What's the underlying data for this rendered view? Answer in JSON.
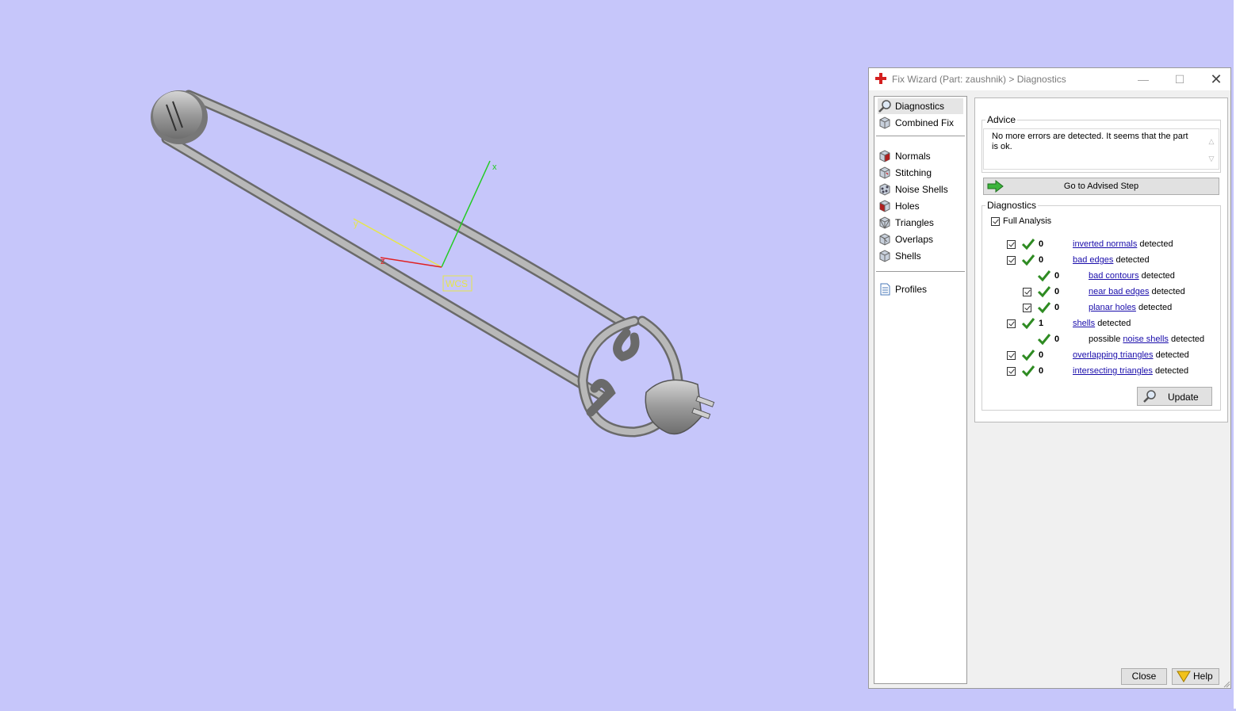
{
  "viewport": {
    "wcs_label": "WCS",
    "axes": {
      "x": "x",
      "y": "y",
      "z": "z"
    },
    "background": "#c6c6fa"
  },
  "dialog": {
    "title": "Fix Wizard (Part: zaushnik) > Diagnostics",
    "steps": [
      {
        "label": "Diagnostics",
        "icon": "magnifier-icon",
        "selected": true
      },
      {
        "label": "Combined Fix",
        "icon": "cube-icon"
      },
      {
        "label": "Normals",
        "icon": "normals-cube-icon"
      },
      {
        "label": "Stitching",
        "icon": "stitching-cube-icon"
      },
      {
        "label": "Noise Shells",
        "icon": "noise-shells-icon"
      },
      {
        "label": "Holes",
        "icon": "holes-cube-icon"
      },
      {
        "label": "Triangles",
        "icon": "triangles-cube-icon"
      },
      {
        "label": "Overlaps",
        "icon": "overlaps-cube-icon"
      },
      {
        "label": "Shells",
        "icon": "shells-cube-icon"
      },
      {
        "label": "Profiles",
        "icon": "document-icon"
      }
    ],
    "advice": {
      "legend": "Advice",
      "text": "No more errors are detected. It seems that the part is ok."
    },
    "advised_button": "Go to Advised Step",
    "diagnostics": {
      "legend": "Diagnostics",
      "full_analysis": "Full Analysis",
      "rows": [
        {
          "count": "0",
          "link": "inverted normals",
          "suffix": "detected",
          "checkbox": true
        },
        {
          "count": "0",
          "link": "bad edges",
          "suffix": "detected",
          "checkbox": true
        },
        {
          "count": "0",
          "link": "bad contours",
          "suffix": "detected",
          "checkbox": false
        },
        {
          "count": "0",
          "link": "near bad edges",
          "suffix": "detected",
          "checkbox": true
        },
        {
          "count": "0",
          "link": "planar holes",
          "suffix": "detected",
          "checkbox": true
        },
        {
          "count": "1",
          "link": "shells",
          "suffix": "detected",
          "checkbox": true
        },
        {
          "count": "0",
          "prefix": "possible",
          "link": "noise shells",
          "suffix": "detected",
          "checkbox": false
        },
        {
          "count": "0",
          "link": "overlapping triangles",
          "suffix": "detected",
          "checkbox": true
        },
        {
          "count": "0",
          "link": "intersecting triangles",
          "suffix": "detected",
          "checkbox": true
        }
      ]
    },
    "update_button": "Update",
    "close_button": "Close",
    "help_button": "Help",
    "colors": {
      "link": "#1a0dab",
      "check": "#2e8b22",
      "selected_step": "#e5e5e5"
    }
  }
}
